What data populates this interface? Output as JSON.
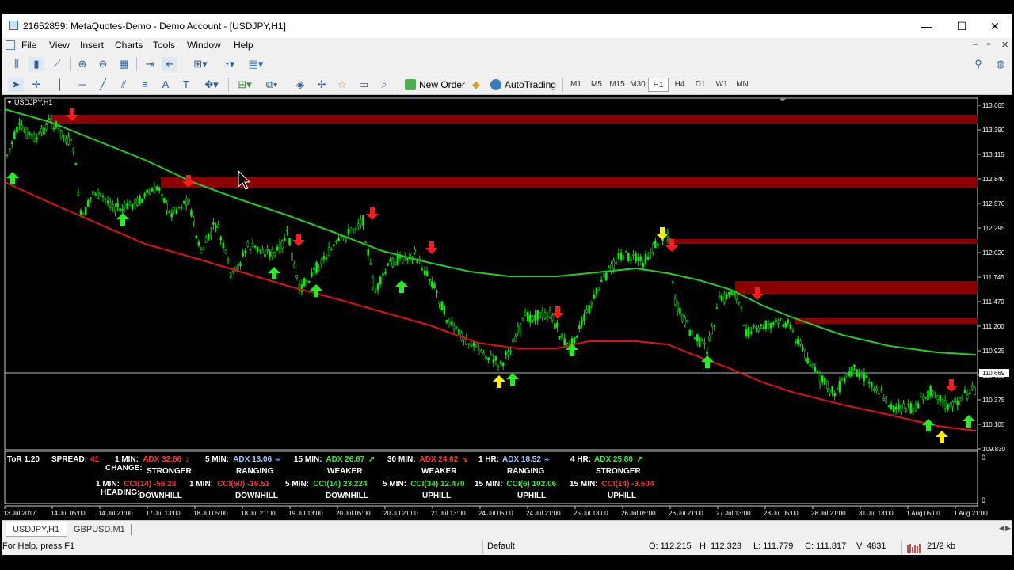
{
  "window": {
    "title": "21652859: MetaQuotes-Demo - Demo Account - [USDJPY,H1]",
    "minimize": "—",
    "maximize": "☐",
    "close": "✕"
  },
  "menu": {
    "items": [
      "File",
      "View",
      "Insert",
      "Charts",
      "Tools",
      "Window",
      "Help"
    ],
    "mdi_minimize": "–",
    "mdi_restore": "▫",
    "mdi_close": "✕"
  },
  "toolbar": {
    "new_order": "New Order",
    "autotrading": "AutoTrading",
    "timeframes": [
      "M1",
      "M5",
      "M15",
      "M30",
      "H1",
      "H4",
      "D1",
      "W1",
      "MN"
    ],
    "active_timeframe": "H1"
  },
  "chart": {
    "symbol_label": "USDJPY,H1",
    "price_labels": [
      "113.665",
      "113.390",
      "113.115",
      "112.840",
      "112.570",
      "112.295",
      "112.020",
      "111.745",
      "111.470",
      "111.200",
      "110.925",
      "110.650",
      "110.375",
      "110.105",
      "109.830"
    ],
    "current_price": "110.669",
    "date_labels": [
      "13 Jul 2017",
      "14 Jul 05:00",
      "14 Jul 21:00",
      "17 Jul 13:00",
      "18 Jul 05:00",
      "18 Jul 21:00",
      "19 Jul 13:00",
      "20 Jul 05:00",
      "20 Jul 21:00",
      "21 Jul 13:00",
      "24 Jul 05:00",
      "24 Jul 21:00",
      "25 Jul 13:00",
      "26 Jul 05:00",
      "26 Jul 21:00",
      "27 Jul 13:00",
      "28 Jul 05:00",
      "28 Jul 21:00",
      "31 Jul 13:00",
      "1 Aug 05:00",
      "1 Aug 21:00"
    ],
    "sub_window_zero": "0",
    "sub_window_zero_bottom": "0",
    "colors": {
      "background": "#000000",
      "candles": "#00ff00",
      "upper_ma": "#22cc22",
      "lower_ma": "#dd1111",
      "resistance_zone": "#8b0000",
      "down_arrow": "#ff1a1a",
      "up_arrow": "#22ee22",
      "strong_arrow": "#ffee00"
    }
  },
  "indicator": {
    "name": "ToR 1.20",
    "spread_label": "SPREAD:",
    "spread_value": "41",
    "row1": [
      {
        "tf": "1 MIN:",
        "value": "ADX 32.66",
        "arrow": "↓",
        "color": "#ff3333"
      },
      {
        "tf": "5 MIN:",
        "value": "ADX 13.06",
        "arrow": "≈",
        "color": "#9fc6ff"
      },
      {
        "tf": "15 MIN:",
        "value": "ADX 26.67",
        "arrow": "↗",
        "color": "#33ee33"
      },
      {
        "tf": "30 MIN:",
        "value": "ADX 24.62",
        "arrow": "↘",
        "color": "#ff3333"
      },
      {
        "tf": "1 HR:",
        "value": "ADX 18.52",
        "arrow": "≈",
        "color": "#9fc6ff"
      },
      {
        "tf": "4 HR:",
        "value": "ADX 25.80",
        "arrow": "↗",
        "color": "#33ee33"
      }
    ],
    "change_label": "CHANGE:",
    "row2": [
      "STRONGER",
      "RANGING",
      "WEAKER",
      "WEAKER",
      "RANGING",
      "STRONGER"
    ],
    "row3": [
      {
        "tf": "1 MIN:",
        "value": "CCI(14) -56.28",
        "color": "#ff3333"
      },
      {
        "tf": "1 MIN:",
        "value": "CCI(50) -16.51",
        "color": "#ff3333"
      },
      {
        "tf": "5 MIN:",
        "value": "CCI(14) 23.224",
        "color": "#33ee33"
      },
      {
        "tf": "5 MIN:",
        "value": "CCI(34) 12.470",
        "color": "#33ee33"
      },
      {
        "tf": "15 MIN:",
        "value": "CCI(6) 102.06",
        "color": "#33ee33"
      },
      {
        "tf": "15 MIN:",
        "value": "CCI(14) -3.504",
        "color": "#ff3333"
      }
    ],
    "heading_label": "HEADING:",
    "row4": [
      "DOWNHILL",
      "DOWNHILL",
      "DOWNHILL",
      "UPHILL",
      "UPHILL",
      "UPHILL"
    ]
  },
  "tabs": [
    "USDJPY,H1",
    "GBPUSD,M1"
  ],
  "status": {
    "help": "For Help, press F1",
    "profile": "Default",
    "open": "O: 112.215",
    "high": "H: 112.323",
    "low": "L: 111.779",
    "close": "C: 111.817",
    "volume": "V: 4831",
    "traffic": "21/2 kb"
  }
}
